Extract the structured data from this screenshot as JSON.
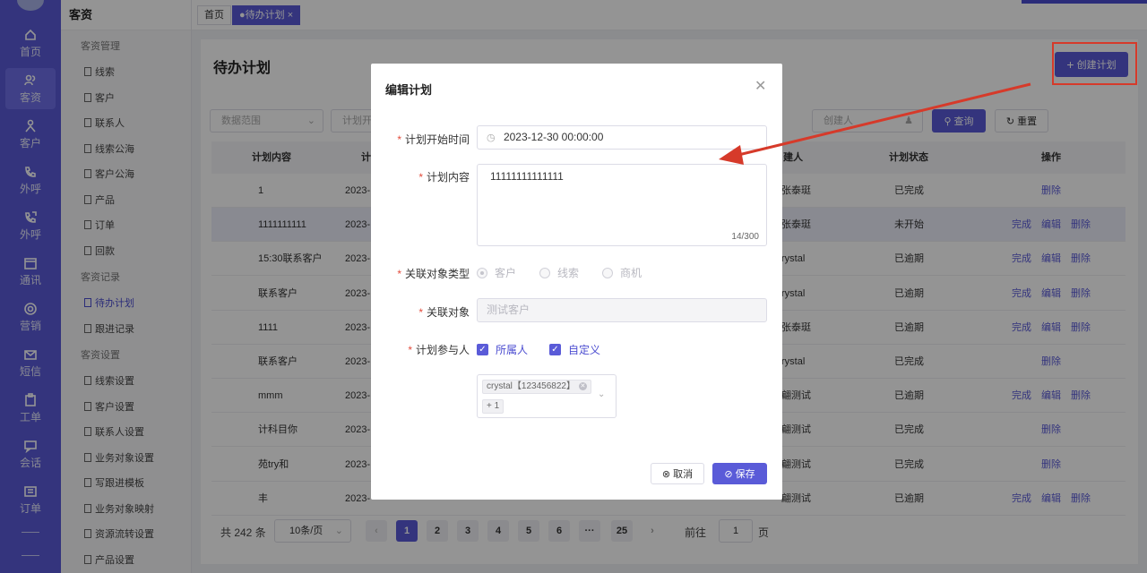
{
  "app": {
    "module_title": "客资",
    "accent_color": "#5a5bd8",
    "annotation_color": "#d63a2a"
  },
  "rail": [
    {
      "label": "首页",
      "icon": "home-icon"
    },
    {
      "label": "客资",
      "icon": "users-icon",
      "active": true
    },
    {
      "label": "客户",
      "icon": "person-icon"
    },
    {
      "label": "外呼",
      "icon": "phone-out-icon"
    },
    {
      "label": "外呼",
      "icon": "phone-in-icon"
    },
    {
      "label": "通讯",
      "icon": "calendar-icon"
    },
    {
      "label": "营销",
      "icon": "gear-icon"
    },
    {
      "label": "短信",
      "icon": "mail-icon"
    },
    {
      "label": "工单",
      "icon": "clipboard-icon"
    },
    {
      "label": "会话",
      "icon": "chat-icon"
    },
    {
      "label": "订单",
      "icon": "list-icon"
    }
  ],
  "submenu": {
    "groups": [
      {
        "title": "客资管理",
        "items": [
          "线索",
          "客户",
          "联系人",
          "线索公海",
          "客户公海",
          "产品",
          "订单",
          "回款"
        ]
      },
      {
        "title": "客资记录",
        "items": [
          "待办计划",
          "跟进记录"
        ]
      },
      {
        "title": "客资设置",
        "items": [
          "线索设置",
          "客户设置",
          "联系人设置",
          "业务对象设置",
          "写跟进模板",
          "业务对象映射",
          "资源流转设置",
          "产品设置"
        ]
      }
    ],
    "active_item": "待办计划"
  },
  "tabs": [
    {
      "label": "首页"
    },
    {
      "label": "●待办计划 ×",
      "active": true
    }
  ],
  "page": {
    "title": "待办计划",
    "create_button": "创建计划",
    "filters": {
      "date_range": "数据范围",
      "plan_time": "计划开",
      "creator": "创建人",
      "query": "查询",
      "reset": "重置"
    },
    "columns": [
      "计划内容",
      "计",
      "建人",
      "计划状态",
      "操作"
    ],
    "rows": [
      {
        "content": "1",
        "time": "2023-",
        "creator": "张泰珽",
        "status": "已完成",
        "actions": [
          "删除"
        ]
      },
      {
        "content": "1111111111",
        "time": "2023-",
        "creator": "张泰珽",
        "status": "未开始",
        "actions": [
          "完成",
          "编辑",
          "删除"
        ],
        "selected": true
      },
      {
        "content": "15:30联系客户",
        "time": "2023-",
        "creator": "rystal",
        "status": "已逾期",
        "actions": [
          "完成",
          "编辑",
          "删除"
        ]
      },
      {
        "content": "联系客户",
        "time": "2023-",
        "creator": "rystal",
        "status": "已逾期",
        "actions": [
          "完成",
          "编辑",
          "删除"
        ]
      },
      {
        "content": "1111",
        "time": "2023-",
        "creator": "张泰珽",
        "status": "已逾期",
        "actions": [
          "完成",
          "编辑",
          "删除"
        ]
      },
      {
        "content": "联系客户",
        "time": "2023-",
        "creator": "rystal",
        "status": "已完成",
        "actions": [
          "删除"
        ]
      },
      {
        "content": "mmm",
        "time": "2023-",
        "creator": "翩测试",
        "status": "已逾期",
        "actions": [
          "完成",
          "编辑",
          "删除"
        ]
      },
      {
        "content": "计科目你",
        "time": "2023-",
        "creator": "翩测试",
        "status": "已完成",
        "actions": [
          "删除"
        ]
      },
      {
        "content": "苑try和",
        "time": "2023-",
        "creator": "翩测试",
        "status": "已完成",
        "actions": [
          "删除"
        ]
      },
      {
        "content": "丰",
        "time": "2023-",
        "creator": "翩测试",
        "status": "已逾期",
        "actions": [
          "完成",
          "编辑",
          "删除"
        ]
      }
    ],
    "pagination": {
      "total": "共 242 条",
      "page_size": "10条/页",
      "pages": [
        "1",
        "2",
        "3",
        "4",
        "5",
        "6",
        "···",
        "25"
      ],
      "current": "1",
      "goto_label": "前往",
      "goto_value": "1",
      "page_suffix": "页"
    }
  },
  "dialog": {
    "title": "编辑计划",
    "start_time_label": "计划开始时间",
    "start_time_value": "2023-12-30 00:00:00",
    "content_label": "计划内容",
    "content_value": "11111111111111",
    "content_count": "14/300",
    "object_type_label": "关联对象类型",
    "object_type_options": [
      "客户",
      "线索",
      "商机"
    ],
    "object_type_selected": "客户",
    "object_label": "关联对象",
    "object_placeholder": "测试客户",
    "participants_label": "计划参与人",
    "participant_options": [
      "所属人",
      "自定义"
    ],
    "participant_tags": [
      "crystal【123456822】",
      "+ 1"
    ],
    "cancel": "取消",
    "save": "保存"
  }
}
